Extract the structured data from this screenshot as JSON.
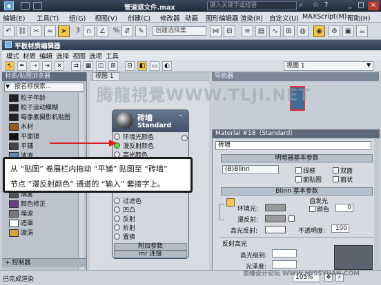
{
  "app": {
    "file_title": "管道遮文件.max",
    "search_placeholder": "键入关键字或短语"
  },
  "main_menu": [
    "编辑(E)",
    "工具(T)",
    "组(G)",
    "视图(V)",
    "创建(C)",
    "修改器",
    "动画",
    "图形编辑器",
    "渲染(R)",
    "自定义(U)",
    "MAXScript(M)",
    "帮助(H)"
  ],
  "main_toolbar": {
    "selection_set": "创建选择集",
    "snap_label": "3",
    "angle_label": "%"
  },
  "sme": {
    "title": "平板材质编辑器",
    "menu": [
      "模式",
      "材质",
      "编辑",
      "选择",
      "视图",
      "选项",
      "工具"
    ],
    "view_select": "视图 1",
    "browser": {
      "header": "材质/贴图浏览器",
      "search_placeholder": "按名称搜索...",
      "items": [
        "粒子年龄",
        "粒子运动模糊",
        "每像素摄影机贴图",
        "木材",
        "平面镜",
        "平铺",
        "波浪",
        "细胞",
        "烟雾",
        "颜色修正",
        "噪波",
        "遮罩",
        "漩涡"
      ],
      "footer": "+ 控制器"
    },
    "view_tab": "视图 1",
    "nav_header": "导航器",
    "node": {
      "name": "砖墙",
      "type": "Standard",
      "slots": [
        "环境光颜色",
        "漫反射颜色",
        "高光颜色",
        "过滤色",
        "凹凸",
        "反射",
        "折射",
        "置换"
      ],
      "rollout_params": "附加参数",
      "rollout_mr": "mr 连接"
    },
    "props": {
      "material_title": "Material #18（Standard）",
      "name_value": "砖墙",
      "section_basic": "明暗器基本参数",
      "shader": "(B)Blinn",
      "opt_wire": "线框",
      "opt_two_sided": "双面",
      "opt_face_map": "面贴图",
      "opt_faceted": "面状",
      "section_blinn": "Blinn 基本参数",
      "ambient": "环境光:",
      "diffuse": "漫反射:",
      "specular": "高光反射:",
      "self_illum": "自发光",
      "color_opt": "颜色",
      "color_value": "0",
      "opacity": "不透明度:",
      "opacity_value": "100",
      "spec_highlights": "反射高光",
      "spec_level": "高光级别:",
      "gloss": "光泽度:"
    }
  },
  "status": {
    "text": "已完成渲染",
    "zoom": "105%"
  },
  "callout": {
    "line1": "从 “贴图” 卷展栏内拖动 “平铺” 贴图至 “砖墙”",
    "line2": "节点 “漫反射颜色” 通道的 “输入” 套接字上。"
  },
  "watermark": "腾龍視覺WWW.TLJI.NET",
  "watermark_small": "思缘设计论坛 WWW.MISSYUAN.COM"
}
